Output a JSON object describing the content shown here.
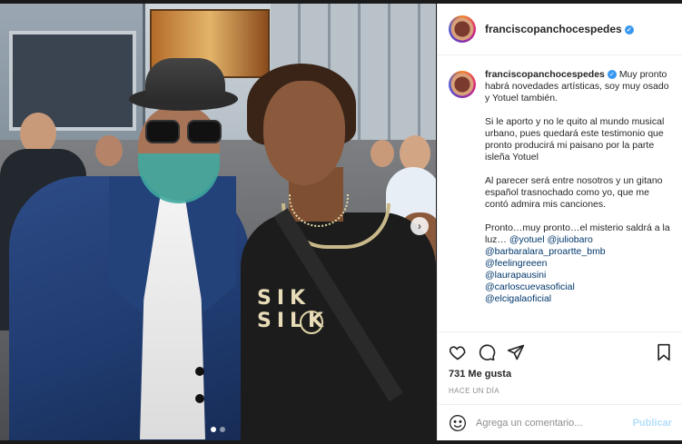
{
  "post": {
    "username": "franciscopanchocespedes",
    "verified": true,
    "caption": {
      "p1": "Muy pronto habrá novedades artísticas, soy muy osado y Yotuel también.",
      "p2": "Si le aporto y no le quito al mundo musical urbano, pues quedará este testimonio que pronto producirá mi paisano por la parte isleña Yotuel",
      "p3": "Al parecer será entre nosotros y un gitano español trasnochado como yo, que me contó admira mis canciones.",
      "p4_text": "Pronto…muy pronto…el misterio saldrá a la luz…",
      "p4_mention1": "@yotuel",
      "p4_mention2": "@juliobaro",
      "mentions": [
        "@barbaralara_proartte_bmb",
        "@feelingreeen",
        "@laurapausini",
        "@carloscuevasoficial",
        "@elcigalaoficial"
      ]
    },
    "likes": "731 Me gusta",
    "time": "HACE UN DÍA",
    "comment_placeholder": "Agrega un comentario...",
    "publish_label": "Publicar"
  },
  "photo": {
    "tank_logo": "SIK SILK",
    "carousel": {
      "current": 1,
      "total": 2
    }
  },
  "icons": {
    "like": "heart-icon",
    "comment": "comment-icon",
    "share": "share-icon",
    "save": "bookmark-icon",
    "emoji": "emoji-icon",
    "next": "chevron-right-icon"
  },
  "colors": {
    "link": "#00376b",
    "verified": "#3897f0",
    "publish_disabled": "#b2dffc"
  }
}
